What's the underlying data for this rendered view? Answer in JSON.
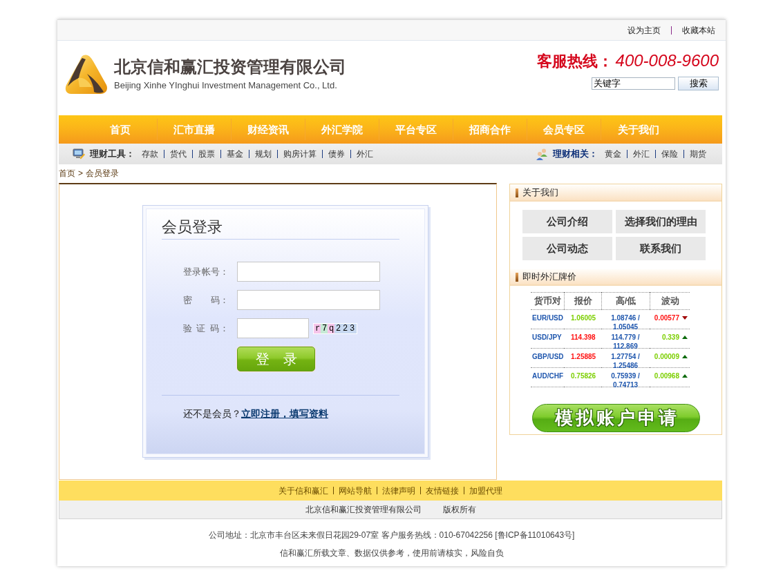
{
  "top_links": [
    {
      "label": "设为主页"
    },
    {
      "label": "收藏本站"
    }
  ],
  "header": {
    "company_name": "北京信和赢汇投资管理有限公司",
    "company_name_en": "Beijing Xinhe YInghui Investment Management Co., Ltd.",
    "hotline_label": "客服热线：",
    "hotline_number": "400-008-9600",
    "search": {
      "value": "关键字",
      "button": "搜索"
    }
  },
  "nav": [
    {
      "label": "首页"
    },
    {
      "label": "汇市直播"
    },
    {
      "label": "财经资讯"
    },
    {
      "label": "外汇学院"
    },
    {
      "label": "平台专区"
    },
    {
      "label": "招商合作"
    },
    {
      "label": "会员专区"
    },
    {
      "label": "关于我们"
    }
  ],
  "tools_bar": {
    "tools": {
      "title": "理财工具：",
      "links": [
        "存款",
        "货代",
        "股票",
        "基金",
        "规划",
        "购房计算",
        "债券",
        "外汇"
      ]
    },
    "related": {
      "title": "理财相关：",
      "links": [
        "黄金",
        "外汇",
        "保险",
        "期货"
      ]
    }
  },
  "breadcrumb": {
    "items": [
      "首页",
      "会员登录"
    ],
    "separator": ">"
  },
  "login": {
    "title": "会员登录",
    "fields": [
      {
        "kind": "account",
        "label": "登录帐号："
      },
      {
        "kind": "password",
        "label": "密　　码："
      },
      {
        "kind": "captcha",
        "label": "验 证 码：",
        "captcha": "r7q223"
      }
    ],
    "submit": "登　录",
    "register_prompt": "还不是会员？",
    "register_link": "立即注册，填写资料"
  },
  "sidebar": {
    "about": {
      "title": "关于我们",
      "links": [
        "公司介绍",
        "选择我们的理由",
        "公司动态",
        "联系我们"
      ]
    },
    "rates": {
      "title": "即时外汇牌价",
      "columns": [
        "货币对",
        "报价",
        "高/低",
        "波动"
      ],
      "rows": [
        {
          "pair": "EUR/USD",
          "price": "1.06005",
          "price_up": true,
          "high_low": "1.08746 / 1.05045",
          "change": "0.00577",
          "up": false
        },
        {
          "pair": "USD/JPY",
          "price": "114.398",
          "price_up": false,
          "high_low": "114.779 / 112.869",
          "change": "0.339",
          "up": true
        },
        {
          "pair": "GBP/USD",
          "price": "1.25885",
          "price_up": false,
          "high_low": "1.27754 / 1.25486",
          "change": "0.00009",
          "up": true
        },
        {
          "pair": "AUD/CHF",
          "price": "0.75826",
          "price_up": true,
          "high_low": "0.75939 / 0.74713",
          "change": "0.00968",
          "up": true
        }
      ]
    },
    "demo_button": "模拟账户申请"
  },
  "footer": {
    "links": [
      "关于信和赢汇",
      "网站导航",
      "法律声明",
      "友情链接",
      "加盟代理"
    ],
    "copyright": [
      "北京信和赢汇投资管理有限公司",
      "版权所有"
    ],
    "address": "公司地址：北京市丰台区未来假日花园29-07室 客户服务热线：010-67042256 [鲁ICP备11010643号]",
    "disclaimer": "信和赢汇所载文章、数据仅供参考，使用前请核实，风险自负"
  }
}
